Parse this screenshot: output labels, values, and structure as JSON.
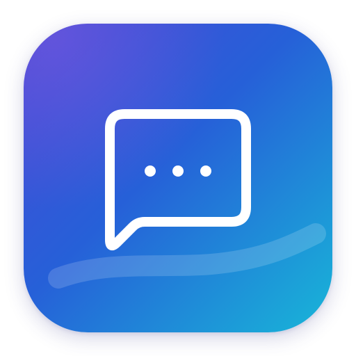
{
  "app_icon": {
    "name": "chat-bubble-app-icon",
    "glyph": "speech-bubble-with-ellipsis-icon",
    "colors": {
      "gradient_top_left": "#4a49d6",
      "gradient_mid": "#2660d8",
      "gradient_bottom_right": "#18b6d8",
      "glyph_stroke": "#ffffff",
      "swoosh": "#ffffff"
    }
  }
}
